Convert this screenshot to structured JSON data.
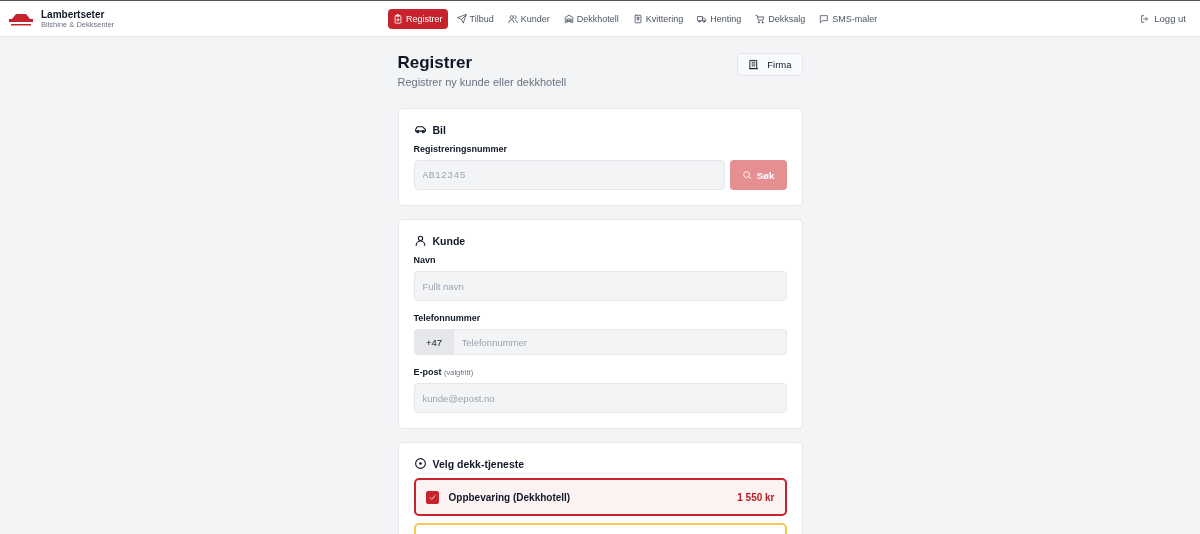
{
  "brand": {
    "name": "Lambertseter",
    "tagline": "Bilshine & Dekksenter"
  },
  "nav": [
    {
      "label": "Registrer",
      "selected": true
    },
    {
      "label": "Tilbud",
      "selected": false
    },
    {
      "label": "Kunder",
      "selected": false
    },
    {
      "label": "Dekkhotell",
      "selected": false
    },
    {
      "label": "Kvittering",
      "selected": false
    },
    {
      "label": "Henting",
      "selected": false
    },
    {
      "label": "Dekksalg",
      "selected": false
    },
    {
      "label": "SMS-maler",
      "selected": false
    }
  ],
  "logout": "Logg ut",
  "page": {
    "title": "Registrer",
    "subtitle": "Registrer ny kunde eller dekkhotell",
    "company_button": "Firma"
  },
  "car": {
    "title": "Bil",
    "label": "Registreringsnummer",
    "placeholder": "AB12345",
    "search_button": "Søk",
    "search_disabled": true
  },
  "customer": {
    "title": "Kunde",
    "name_label": "Navn",
    "name_placeholder": "Fullt navn",
    "phone_label": "Telefonnummer",
    "phone_prefix": "+47",
    "phone_placeholder": "Telefonnummer",
    "email_label": "E-post",
    "email_hint": "(valgfritt)",
    "email_placeholder": "kunde@epost.no"
  },
  "services": {
    "title": "Velg dekk-tjeneste",
    "items": [
      {
        "label": "Oppbevaring (Dekkhotell)",
        "price": "1 550 kr",
        "selected": true,
        "color": "#c8232c"
      },
      {
        "selected": false,
        "color": "#f2c94c"
      }
    ]
  }
}
